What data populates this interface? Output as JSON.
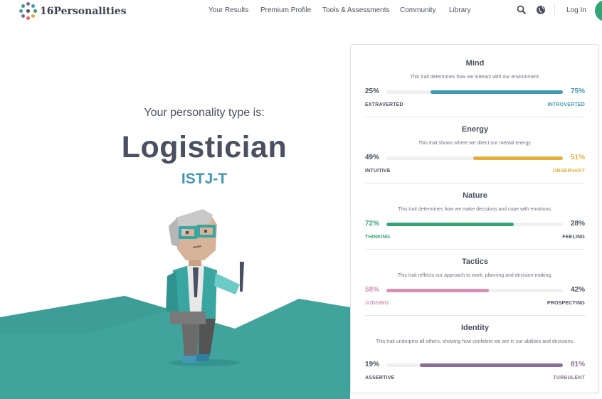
{
  "brand": {
    "name": "16Personalities"
  },
  "nav": {
    "items": [
      "Your Results",
      "Premium Profile",
      "Tools & Assessments",
      "Community",
      "Library"
    ],
    "login": "Log In",
    "icons": [
      "search-icon",
      "globe-icon"
    ]
  },
  "hero": {
    "pre": "Your personality type is:",
    "title": "Logistician",
    "code": "ISTJ-T"
  },
  "colors": {
    "mind": "#4298b4",
    "energy": "#e4ae3a",
    "nature": "#33a474",
    "tactics": "#d88fb2",
    "identity": "#8c6e99",
    "teal_bg": "#40a39c",
    "neutral": "#4a5061"
  },
  "traits": [
    {
      "title": "Mind",
      "desc": "This trait determines how we interact with our environment.",
      "left_pct": "25%",
      "right_pct": "75%",
      "left_label": "EXTRAVERTED",
      "right_label": "INTROVERTED",
      "fill_side": "right",
      "fill_fraction": 0.75,
      "highlight": "right",
      "color": "#4298b4"
    },
    {
      "title": "Energy",
      "desc": "This trait shows where we direct our mental energy.",
      "left_pct": "49%",
      "right_pct": "51%",
      "left_label": "INTUITIVE",
      "right_label": "OBSERVANT",
      "fill_side": "right",
      "fill_fraction": 0.51,
      "highlight": "right",
      "color": "#e4ae3a"
    },
    {
      "title": "Nature",
      "desc": "This trait determines how we make decisions and cope with emotions.",
      "left_pct": "72%",
      "right_pct": "28%",
      "left_label": "THINKING",
      "right_label": "FEELING",
      "fill_side": "left",
      "fill_fraction": 0.72,
      "highlight": "left",
      "color": "#33a474"
    },
    {
      "title": "Tactics",
      "desc": "This trait reflects our approach to work, planning and decision-making.",
      "left_pct": "58%",
      "right_pct": "42%",
      "left_label": "JUDGING",
      "right_label": "PROSPECTING",
      "fill_side": "left",
      "fill_fraction": 0.58,
      "highlight": "left",
      "color": "#d88fb2"
    },
    {
      "title": "Identity",
      "desc": "This trait underpins all others, showing how confident we are in our abilities and decisions.",
      "left_pct": "19%",
      "right_pct": "81%",
      "left_label": "ASSERTIVE",
      "right_label": "TURBULENT",
      "fill_side": "right",
      "fill_fraction": 0.81,
      "highlight": "right",
      "color": "#8c6e99"
    }
  ]
}
